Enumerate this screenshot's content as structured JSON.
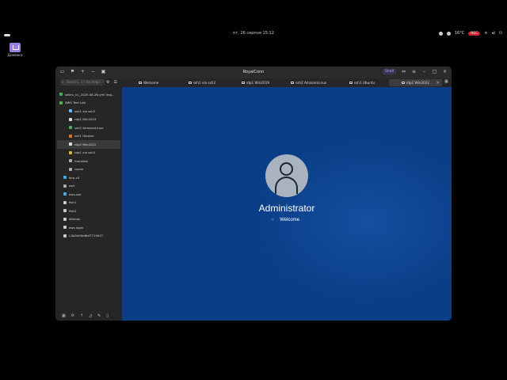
{
  "system": {
    "clock": "пт, 26 серпня 15:12",
    "temperature": "16°C",
    "rec_badge": "REC"
  },
  "desktop": {
    "home_label": "Домівка"
  },
  "window": {
    "title": "RoyalConn",
    "shell_label": "Shell"
  },
  "search": {
    "placeholder": "Search... (⇧ for help)"
  },
  "tabs": [
    {
      "label": "Welcome"
    },
    {
      "label": "ssh1 via ssh2"
    },
    {
      "label": "rdp1 Win2019"
    },
    {
      "label": "ssh2 AmazonLinux"
    },
    {
      "label": "ssh1 Ubuntu"
    },
    {
      "label": "rdp2 Win2022"
    }
  ],
  "sidebar": {
    "items": [
      {
        "label": "sebru_v1_2025.08.26.yml Imp...",
        "color": "#4caf50"
      },
      {
        "label": "AWS Test Lab",
        "color": "#4caf50"
      },
      {
        "label": "ssh1 via ssh2",
        "color": "#6bbcf0"
      },
      {
        "label": "rdp1 Win2019",
        "color": "#dddddd"
      },
      {
        "label": "ssh2 AmazonLinux",
        "color": "#4caf50"
      },
      {
        "label": "ssh1 Ubuntu",
        "color": "#e07030"
      },
      {
        "label": "rdp2 Win2022",
        "color": "#dddddd"
      },
      {
        "label": "rdp1 via ssh2",
        "color": "#e0b030"
      },
      {
        "label": "homelab",
        "color": "#aaaaaa"
      },
      {
        "label": "router",
        "color": "#aaaaaa"
      },
      {
        "label": "kiro-cli",
        "color": "#4aa8e0"
      },
      {
        "label": "awt",
        "color": "#aaaaaa"
      },
      {
        "label": "aws-sso",
        "color": "#4aa8e0"
      },
      {
        "label": "fish1",
        "color": "#cccccc"
      },
      {
        "label": "fish2",
        "color": "#cccccc"
      },
      {
        "label": "Winbox",
        "color": "#cccccc"
      },
      {
        "label": "aws login",
        "color": "#cccccc"
      },
      {
        "label": "i-0b5e04e6bf7719d27",
        "color": "#cccccc"
      }
    ]
  },
  "remote": {
    "username": "Administrator",
    "status": "Welcome",
    "background": "#0a3e87"
  }
}
